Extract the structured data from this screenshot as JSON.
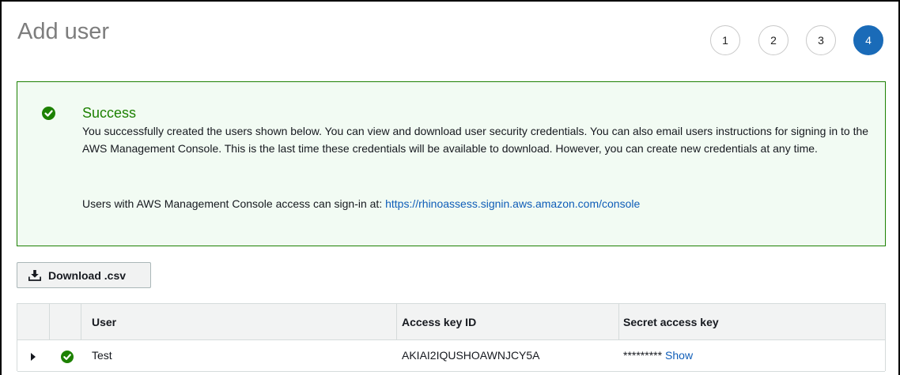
{
  "page": {
    "title": "Add user"
  },
  "steps": [
    "1",
    "2",
    "3",
    "4"
  ],
  "active_step": 4,
  "success": {
    "title": "Success",
    "body": "You successfully created the users shown below. You can view and download user security credentials. You can also email users instructions for signing in to the AWS Management Console. This is the last time these credentials will be available to download. However, you can create new credentials at any time.",
    "signin_prefix": "Users with AWS Management Console access can sign-in at:",
    "signin_link": "https://rhinoassess.signin.aws.amazon.com/console"
  },
  "toolbar": {
    "download_label": "Download .csv"
  },
  "table": {
    "columns": [
      "User",
      "Access key ID",
      "Secret access key"
    ],
    "rows": [
      {
        "user": "Test",
        "access_key_id": "AKIAI2IQUSHOAWNJCY5A",
        "secret_masked": "*********",
        "show_label": "Show"
      }
    ]
  },
  "colors": {
    "primary": "#1a6bb8",
    "success": "#1d8102",
    "link": "#0f5db8"
  },
  "icons": {
    "success": "check-circle-icon",
    "download": "download-icon",
    "expand": "caret-right-icon"
  }
}
